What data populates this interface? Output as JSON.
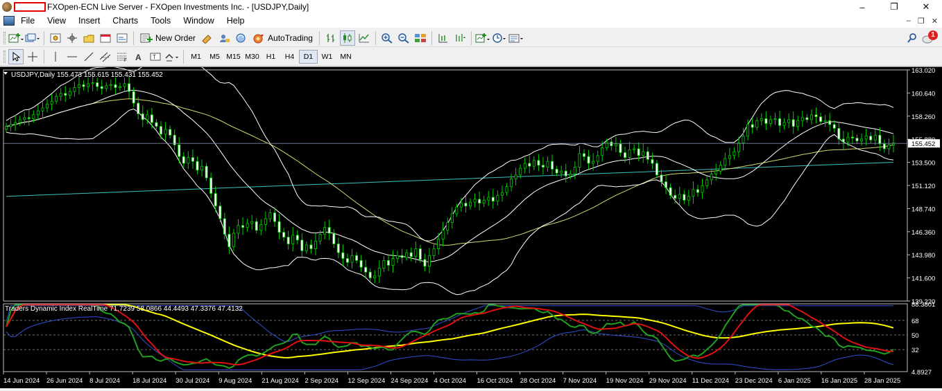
{
  "window": {
    "title": "FXOpen-ECN Live Server - FXOpen Investments Inc. - [USDJPY,Daily]",
    "minimize": "–",
    "maximize": "❐",
    "close": "✕"
  },
  "menu": {
    "items": [
      "File",
      "View",
      "Insert",
      "Charts",
      "Tools",
      "Window",
      "Help"
    ],
    "mdi_minimize": "–",
    "mdi_restore": "❐",
    "mdi_close": "✕"
  },
  "toolbar": {
    "new_order_label": "New Order",
    "autotrading_label": "AutoTrading",
    "notification_count": "1"
  },
  "timeframes": {
    "items": [
      "M1",
      "M5",
      "M15",
      "M30",
      "H1",
      "H4",
      "D1",
      "W1",
      "MN"
    ],
    "active": "D1"
  },
  "chart_data": {
    "type": "line",
    "symbol": "USDJPY",
    "period": "Daily",
    "title": "USDJPY,Daily  155.473 155.615 155.431 155.452",
    "ohlc": {
      "open": 155.473,
      "high": 155.615,
      "low": 155.431,
      "close": 155.452
    },
    "current_price": "155.452",
    "price_axis_labels": [
      "163.020",
      "160.640",
      "158.260",
      "155.880",
      "153.500",
      "151.120",
      "148.740",
      "146.360",
      "143.980",
      "141.600",
      "139.220"
    ],
    "ylim": [
      139.22,
      163.02
    ],
    "date_labels": [
      "14 Jun 2024",
      "26 Jun 2024",
      "8 Jul 2024",
      "18 Jul 2024",
      "30 Jul 2024",
      "9 Aug 2024",
      "21 Aug 2024",
      "2 Sep 2024",
      "12 Sep 2024",
      "24 Sep 2024",
      "4 Oct 2024",
      "16 Oct 2024",
      "28 Oct 2024",
      "7 Nov 2024",
      "19 Nov 2024",
      "29 Nov 2024",
      "11 Dec 2024",
      "23 Dec 2024",
      "6 Jan 2025",
      "16 Jan 2025",
      "28 Jan 2025"
    ],
    "close_series": [
      157.2,
      157.4,
      157.6,
      157.9,
      158.1,
      158.0,
      158.4,
      158.8,
      159.1,
      159.5,
      159.8,
      160.3,
      160.6,
      160.4,
      160.8,
      161.2,
      161.5,
      161.3,
      161.6,
      161.7,
      161.3,
      161.1,
      161.4,
      161.5,
      161.2,
      161.3,
      161.6,
      160.8,
      159.6,
      158.5,
      157.9,
      158.4,
      157.6,
      157.2,
      156.4,
      156.9,
      156.3,
      155.3,
      154.1,
      153.4,
      154.0,
      153.6,
      152.7,
      153.1,
      151.9,
      150.3,
      149.0,
      147.7,
      146.1,
      144.8,
      146.2,
      147.0,
      146.8,
      147.2,
      147.4,
      146.5,
      147.1,
      147.7,
      148.3,
      147.4,
      146.3,
      145.8,
      145.1,
      146.0,
      145.5,
      144.4,
      145.0,
      144.6,
      145.4,
      146.1,
      146.8,
      146.2,
      145.1,
      144.2,
      143.6,
      143.2,
      143.9,
      143.4,
      142.7,
      142.2,
      141.6,
      141.8,
      142.6,
      143.4,
      142.9,
      143.6,
      143.9,
      143.7,
      144.2,
      143.8,
      144.6,
      143.5,
      142.8,
      143.9,
      144.6,
      145.6,
      146.5,
      147.3,
      148.2,
      148.9,
      149.3,
      149.0,
      149.4,
      149.7,
      149.3,
      149.6,
      149.9,
      149.5,
      150.1,
      150.4,
      151.0,
      151.8,
      152.2,
      152.9,
      153.4,
      153.1,
      153.7,
      153.2,
      153.0,
      153.6,
      152.8,
      152.4,
      152.6,
      152.1,
      152.3,
      153.0,
      154.4,
      154.1,
      153.4,
      153.6,
      154.2,
      155.0,
      155.6,
      155.2,
      155.4,
      154.5,
      154.0,
      154.8,
      154.9,
      154.2,
      154.6,
      153.8,
      153.4,
      152.2,
      151.5,
      150.9,
      150.1,
      149.8,
      150.2,
      149.6,
      150.0,
      150.7,
      150.4,
      151.1,
      151.7,
      152.3,
      152.6,
      153.2,
      153.9,
      154.2,
      154.6,
      155.5,
      156.2,
      157.4,
      157.1,
      157.8,
      158.0,
      157.5,
      157.9,
      158.0,
      157.3,
      157.6,
      157.9,
      157.2,
      157.8,
      158.1,
      157.9,
      158.4,
      158.2,
      157.7,
      157.8,
      157.4,
      157.0,
      155.9,
      155.6,
      156.1,
      156.0,
      155.7,
      155.9,
      156.2,
      155.8,
      156.3,
      155.4,
      154.9,
      155.3,
      155.5
    ],
    "bands_period": 20,
    "indicator": {
      "name": "Traders Dynamic Index RealTime",
      "title": "Traders Dynamic Index RealTime 71.7239 58.0866 44.4493 47.3376 47.4132",
      "values": [
        71.7239,
        58.0866,
        44.4493,
        47.3376,
        47.4132
      ],
      "axis_labels": [
        "88.3801",
        "68",
        "50",
        "32",
        "4.8927"
      ],
      "ylim": [
        4.8927,
        88.3801
      ],
      "levels": [
        68,
        50,
        32
      ]
    },
    "colors": {
      "background": "#000000",
      "bull_candle": "#ffffff",
      "bear_candle": "#ffffff",
      "grid": "#3a3a3a",
      "bands": "#ffffff",
      "ma_yellow": "#d8d870",
      "ma_cyan": "#3cc0c0",
      "rsi_green": "#1fa01f",
      "signal_red": "#e01010",
      "market_base_yellow": "#ffff00",
      "volatility_blue": "#3050d0"
    }
  }
}
